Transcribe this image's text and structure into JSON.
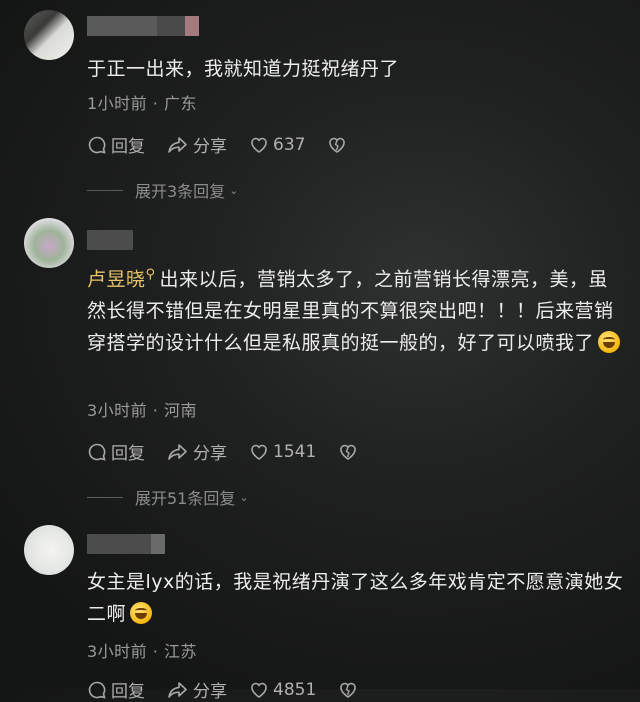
{
  "comments": [
    {
      "text": "于正一出来，我就知道力挺祝绪丹了",
      "time": "1小时前",
      "location": "广东",
      "reply_label": "回复",
      "share_label": "分享",
      "likes": "637",
      "replies_label": "展开3条回复"
    },
    {
      "mention": "卢昱晓",
      "text": "出来以后，营销太多了，之前营销长得漂亮，美，虽然长得不错但是在女明星里真的不算很突出吧！！！后来营销穿搭学的设计什么但是私服真的挺一般的，好了可以喷我了",
      "time": "3小时前",
      "location": "河南",
      "reply_label": "回复",
      "share_label": "分享",
      "likes": "1541",
      "replies_label": "展开51条回复"
    },
    {
      "text": "女主是lyx的话，我是祝绪丹演了这么多年戏肯定不愿意演她女二啊",
      "time": "3小时前",
      "location": "江苏",
      "reply_label": "回复",
      "share_label": "分享",
      "likes": "4851"
    }
  ],
  "meta_separator": "·",
  "colors": {
    "mention": "#e9c46a",
    "text": "#ececec",
    "muted": "#9a9a9a"
  },
  "icons": [
    "comment-bubble-icon",
    "share-arrow-icon",
    "heart-icon",
    "broken-heart-icon",
    "chevron-down-icon",
    "location-pin-icon"
  ]
}
